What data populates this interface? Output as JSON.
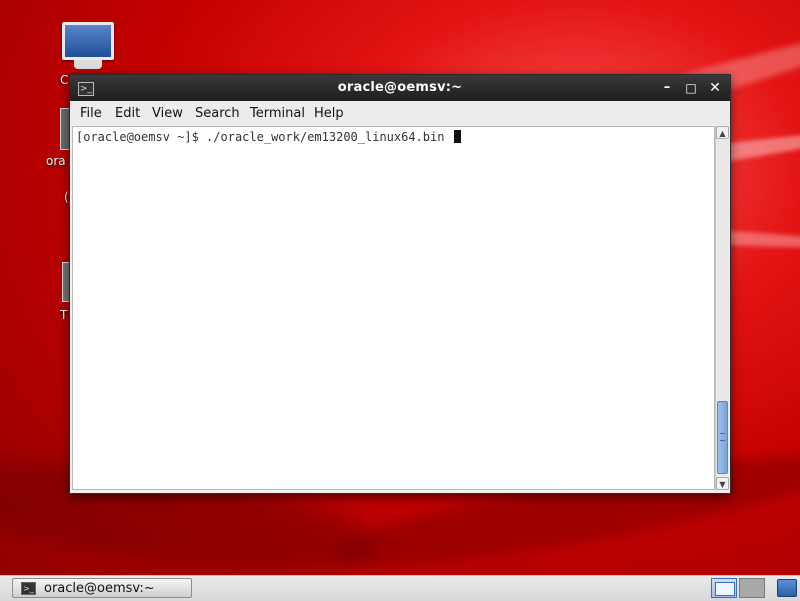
{
  "desktop": {
    "icons": [
      {
        "label": "C"
      },
      {
        "label": "ora"
      },
      {
        "label": "("
      },
      {
        "label": "T"
      }
    ]
  },
  "window": {
    "title": "oracle@oemsv:~",
    "minimize_glyph": "–",
    "maximize_glyph": "□",
    "close_glyph": "✕",
    "menus": [
      "File",
      "Edit",
      "View",
      "Search",
      "Terminal",
      "Help"
    ]
  },
  "terminal": {
    "prompt": "[oracle@oemsv ~]$ ",
    "command": "./oracle_work/em13200_linux64.bin "
  },
  "scrollbar": {
    "up_glyph": "▲",
    "down_glyph": "▼"
  },
  "taskbar": {
    "task_label": "oracle@oemsv:~"
  },
  "colors": {
    "desktop_red": "#c30000",
    "titlebar": "#1e1e1e",
    "scroll_thumb": "#7aa3da"
  },
  "icons": [
    "terminal-icon",
    "computer-icon",
    "workspace-switcher-icon",
    "tray-icon"
  ]
}
